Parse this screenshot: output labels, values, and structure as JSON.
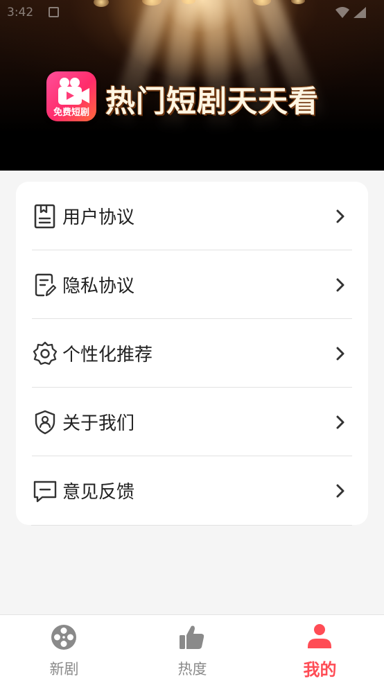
{
  "status_bar": {
    "time": "3:42"
  },
  "hero": {
    "logo_label": "免费短剧",
    "title": "热门短剧天天看"
  },
  "menu": {
    "items": [
      {
        "label": "用户协议",
        "icon": "document-icon"
      },
      {
        "label": "隐私协议",
        "icon": "edit-document-icon"
      },
      {
        "label": "个性化推荐",
        "icon": "settings-gear-icon"
      },
      {
        "label": "关于我们",
        "icon": "shield-user-icon"
      },
      {
        "label": "意见反馈",
        "icon": "message-icon"
      }
    ]
  },
  "tabs": [
    {
      "label": "新剧",
      "icon": "film-reel-icon",
      "active": false
    },
    {
      "label": "热度",
      "icon": "thumbs-up-icon",
      "active": false
    },
    {
      "label": "我的",
      "icon": "user-icon",
      "active": true
    }
  ],
  "colors": {
    "accent": "#ff4c55",
    "inactive": "#8a8a8a",
    "background": "#f5f5f5",
    "card": "#ffffff",
    "logo_gradient_start": "#ff4f9a",
    "logo_gradient_end": "#ff6a3a"
  }
}
